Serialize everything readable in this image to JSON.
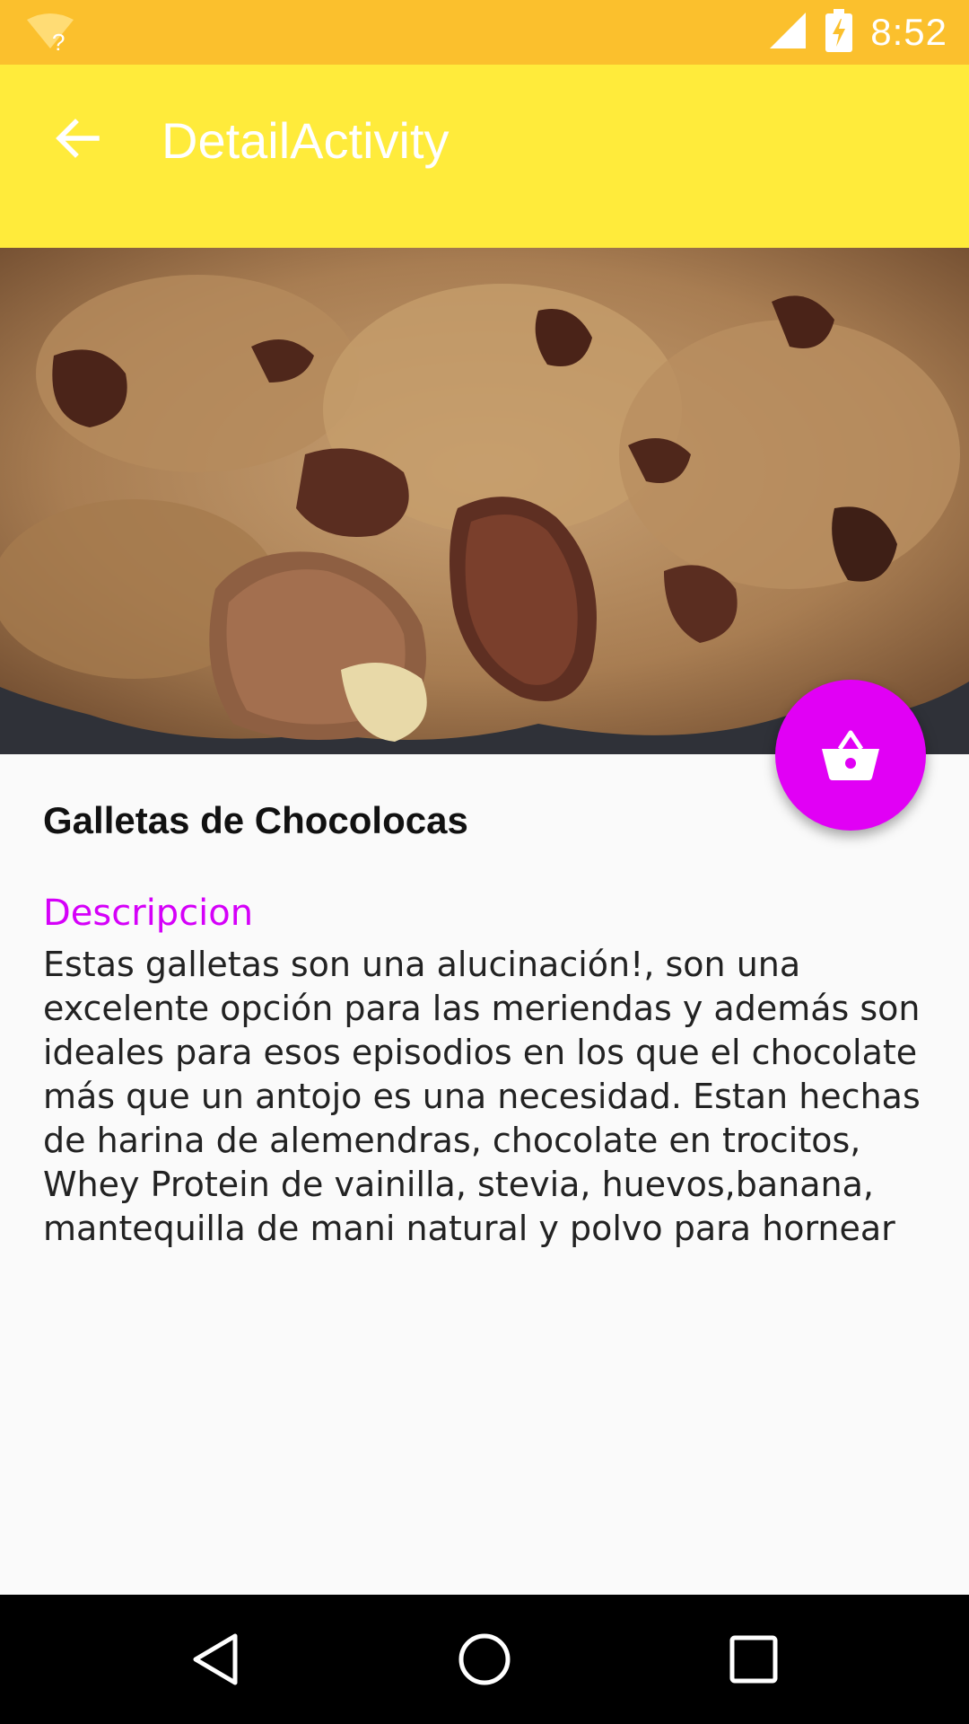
{
  "status_bar": {
    "time": "8:52",
    "icons": [
      "wifi-question-icon",
      "cell-signal-icon",
      "battery-charging-icon"
    ],
    "background": "#fbc02d"
  },
  "app_bar": {
    "title": "DetailActivity",
    "back_icon": "arrow-back-icon",
    "background": "#ffeb3b"
  },
  "hero": {
    "image": "chocolate-cookies-photo"
  },
  "fab": {
    "icon": "shopping-basket-icon",
    "color": "#e100f5"
  },
  "content": {
    "title": "Galletas de Chocolocas",
    "description_label": "Descripcion",
    "description": "Estas galletas son una alucinación!, son una excelente opción para las meriendas y además son ideales para esos episodios en los que el chocolate más que un antojo es una necesidad. Estan hechas de harina de alemendras, chocolate en trocitos, Whey Protein de vainilla, stevia, huevos,banana, mantequilla de mani natural y polvo para hornear",
    "accent": "#d500f9"
  },
  "nav_bar": {
    "buttons": [
      "back-nav-icon",
      "home-nav-icon",
      "recents-nav-icon"
    ]
  }
}
